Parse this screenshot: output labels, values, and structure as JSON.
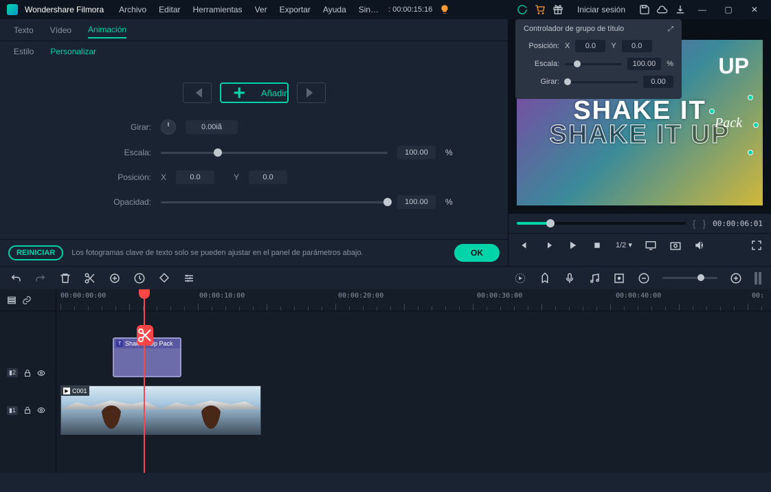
{
  "app": {
    "title": "Wondershare Filmora"
  },
  "menu": [
    "Archivo",
    "Editar",
    "Herramientas",
    "Ver",
    "Exportar",
    "Ayuda"
  ],
  "titlebar": {
    "unsaved": "Sin…",
    "timecode": ": 00:00:15:16",
    "login": "Iniciar sesión"
  },
  "tabs_top": [
    "Texto",
    "Vídeo",
    "Animación"
  ],
  "tabs_sub": [
    "Estilo",
    "Personalizar"
  ],
  "keyframe": {
    "add": "Añadir"
  },
  "params": {
    "rotate_label": "Girar:",
    "rotate_val": "0.00iã",
    "scale_label": "Escala:",
    "scale_val": "100.00",
    "scale_unit": "%",
    "pos_label": "Posición:",
    "pos_x_label": "X",
    "pos_x": "0.0",
    "pos_y_label": "Y",
    "pos_y": "0.0",
    "opacity_label": "Opacidad:",
    "opacity_val": "100.00",
    "opacity_unit": "%"
  },
  "footer": {
    "reset": "REINICIAR",
    "hint": "Los fotogramas clave de texto solo se pueden ajustar en el panel de parámetros abajo.",
    "ok": "OK"
  },
  "floating": {
    "title": "Controlador de grupo de título",
    "pos_label": "Posición:",
    "x_label": "X",
    "x_val": "0.0",
    "y_label": "Y",
    "y_val": "0.0",
    "scale_label": "Escala:",
    "scale_val": "100.00",
    "scale_unit": "%",
    "rotate_label": "Girar:",
    "rotate_val": "0.00"
  },
  "preview": {
    "line1": "SHAKE IT",
    "line2": "SHAKE IT UP",
    "up": "UP",
    "pack": "Pack"
  },
  "progress": {
    "timecode": "00:00:06:01"
  },
  "playback": {
    "ratio": "1/2"
  },
  "ruler": [
    "00:00:00:00",
    "00:00:10:00",
    "00:00:20:00",
    "00:00:30:00",
    "00:00:40:00",
    "00:"
  ],
  "tracks": {
    "t2": "2",
    "t1": "1",
    "title_clip": "Shake It Up Pack",
    "video_clip": "C001"
  }
}
